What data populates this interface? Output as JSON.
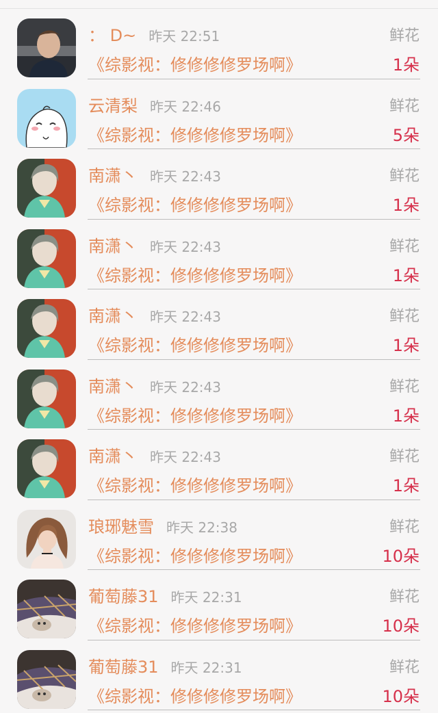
{
  "gifts": [
    {
      "name": "： D~",
      "time": "昨天 22:51",
      "flower_label": "鲜花",
      "book": "《综影视：修修修修罗场啊》",
      "count": "1朵",
      "avatar_icon": "man-selfie-avatar"
    },
    {
      "name": "云清梨",
      "time": "昨天 22:46",
      "flower_label": "鲜花",
      "book": "《综影视：修修修修罗场啊》",
      "count": "5朵",
      "avatar_icon": "cartoon-blob-avatar"
    },
    {
      "name": "南潇丶",
      "time": "昨天 22:43",
      "flower_label": "鲜花",
      "book": "《综影视：修修修修罗场啊》",
      "count": "1朵",
      "avatar_icon": "doll-avatar"
    },
    {
      "name": "南潇丶",
      "time": "昨天 22:43",
      "flower_label": "鲜花",
      "book": "《综影视：修修修修罗场啊》",
      "count": "1朵",
      "avatar_icon": "doll-avatar"
    },
    {
      "name": "南潇丶",
      "time": "昨天 22:43",
      "flower_label": "鲜花",
      "book": "《综影视：修修修修罗场啊》",
      "count": "1朵",
      "avatar_icon": "doll-avatar"
    },
    {
      "name": "南潇丶",
      "time": "昨天 22:43",
      "flower_label": "鲜花",
      "book": "《综影视：修修修修罗场啊》",
      "count": "1朵",
      "avatar_icon": "doll-avatar"
    },
    {
      "name": "南潇丶",
      "time": "昨天 22:43",
      "flower_label": "鲜花",
      "book": "《综影视：修修修修罗场啊》",
      "count": "1朵",
      "avatar_icon": "doll-avatar"
    },
    {
      "name": "琅琊魅雪",
      "time": "昨天 22:38",
      "flower_label": "鲜花",
      "book": "《综影视：修修修修罗场啊》",
      "count": "10朵",
      "avatar_icon": "woman-portrait-avatar"
    },
    {
      "name": "葡萄藤31",
      "time": "昨天 22:31",
      "flower_label": "鲜花",
      "book": "《综影视：修修修修罗场啊》",
      "count": "10朵",
      "avatar_icon": "cat-blanket-avatar"
    },
    {
      "name": "葡萄藤31",
      "time": "昨天 22:31",
      "flower_label": "鲜花",
      "book": "《综影视：修修修修罗场啊》",
      "count": "10朵",
      "avatar_icon": "cat-blanket-avatar"
    }
  ],
  "colors": {
    "name": "#e48c5b",
    "count": "#d6304b",
    "muted": "#a8a8a8"
  }
}
